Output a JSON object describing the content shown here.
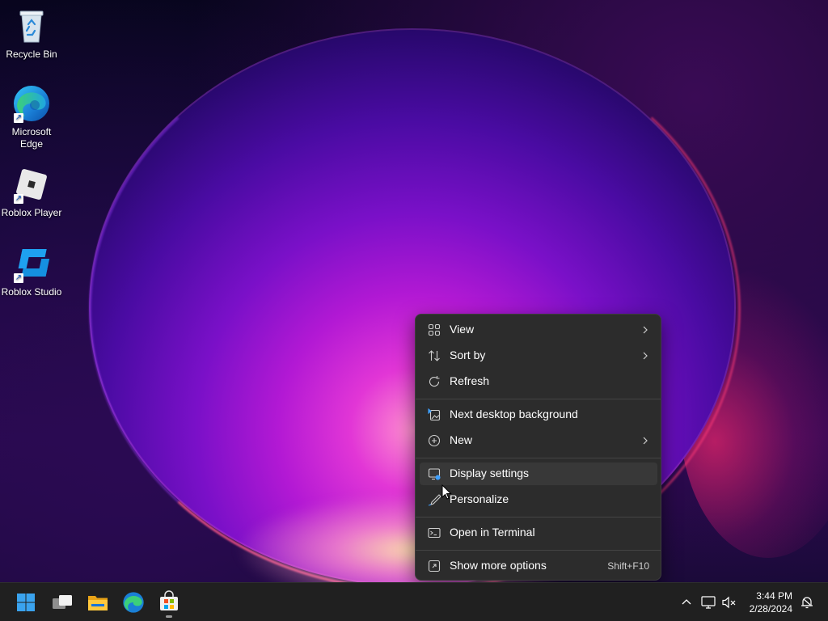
{
  "desktop": {
    "icons": [
      {
        "label": "Recycle Bin",
        "icon": "recycle-bin-icon"
      },
      {
        "label": "Microsoft Edge",
        "icon": "edge-icon"
      },
      {
        "label": "Roblox Player",
        "icon": "roblox-player-icon"
      },
      {
        "label": "Roblox Studio",
        "icon": "roblox-studio-icon"
      }
    ]
  },
  "context_menu": {
    "items": [
      {
        "label": "View",
        "icon": "grid-view-icon",
        "has_submenu": true
      },
      {
        "label": "Sort by",
        "icon": "sort-icon",
        "has_submenu": true
      },
      {
        "label": "Refresh",
        "icon": "refresh-icon",
        "has_submenu": false
      },
      {
        "label": "Next desktop background",
        "icon": "next-background-icon",
        "has_submenu": false
      },
      {
        "label": "New",
        "icon": "new-plus-icon",
        "has_submenu": true
      },
      {
        "label": "Display settings",
        "icon": "display-settings-icon",
        "has_submenu": false,
        "highlighted": true
      },
      {
        "label": "Personalize",
        "icon": "personalize-brush-icon",
        "has_submenu": false
      },
      {
        "label": "Open in Terminal",
        "icon": "terminal-icon",
        "has_submenu": false
      },
      {
        "label": "Show more options",
        "icon": "show-more-options-icon",
        "has_submenu": false,
        "shortcut": "Shift+F10"
      }
    ]
  },
  "taskbar": {
    "apps": [
      "start-icon",
      "task-view-icon",
      "file-explorer-icon",
      "edge-icon",
      "microsoft-store-icon"
    ],
    "clock": {
      "time": "3:44 PM",
      "date": "2/28/2024"
    }
  },
  "colors": {
    "menu_bg": "#2c2c2c",
    "menu_hover": "#383838",
    "taskbar_bg": "#202020",
    "accent_blue": "#1ea0f0"
  }
}
